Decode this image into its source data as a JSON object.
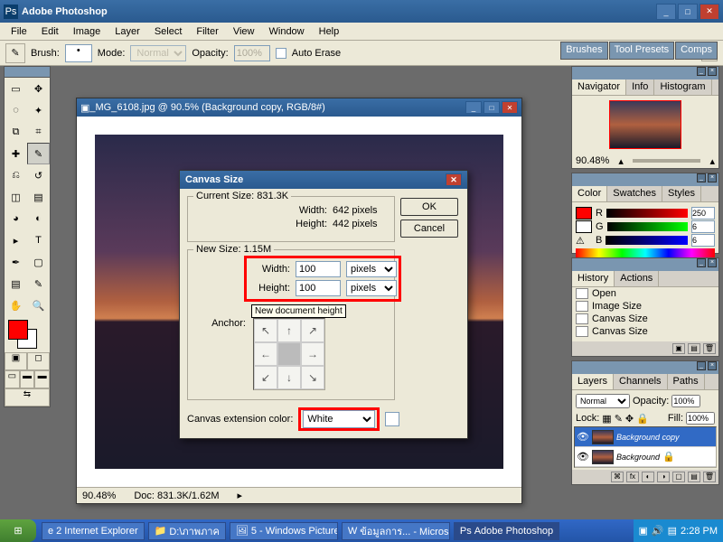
{
  "app": {
    "title": "Adobe Photoshop"
  },
  "menu": [
    "File",
    "Edit",
    "Image",
    "Layer",
    "Select",
    "Filter",
    "View",
    "Window",
    "Help"
  ],
  "options": {
    "brush_label": "Brush:",
    "mode_label": "Mode:",
    "mode_value": "Normal",
    "opacity_label": "Opacity:",
    "opacity_value": "100%",
    "auto_erase": "Auto Erase"
  },
  "panel_tabs": [
    "Brushes",
    "Tool Presets",
    "Comps"
  ],
  "doc": {
    "title": "_MG_6108.jpg @ 90.5% (Background copy, RGB/8#)",
    "zoom": "90.48%",
    "docsize": "Doc: 831.3K/1.62M"
  },
  "dialog": {
    "title": "Canvas Size",
    "current_label": "Current Size: 831.3K",
    "cur_width_l": "Width:",
    "cur_width_v": "642 pixels",
    "cur_height_l": "Height:",
    "cur_height_v": "442 pixels",
    "new_label": "New Size: 1.15M",
    "new_width_l": "Width:",
    "new_width_v": "100",
    "new_width_u": "pixels",
    "new_height_l": "Height:",
    "new_height_v": "100",
    "new_height_u": "pixels",
    "tooltip": "New document height",
    "anchor_l": "Anchor:",
    "ext_label": "Canvas extension color:",
    "ext_value": "White",
    "ok": "OK",
    "cancel": "Cancel"
  },
  "nav": {
    "tabs": [
      "Navigator",
      "Info",
      "Histogram"
    ],
    "zoom": "90.48%"
  },
  "color": {
    "tabs": [
      "Color",
      "Swatches",
      "Styles"
    ],
    "r": "R",
    "g": "G",
    "b": "B",
    "rv": "250",
    "gv": "6",
    "bv": "6"
  },
  "history": {
    "tabs": [
      "History",
      "Actions"
    ],
    "items": [
      "Open",
      "Image Size",
      "Canvas Size",
      "Canvas Size"
    ]
  },
  "layers": {
    "tabs": [
      "Layers",
      "Channels",
      "Paths"
    ],
    "blend": "Normal",
    "opacity_l": "Opacity:",
    "opacity": "100%",
    "lock_l": "Lock:",
    "fill_l": "Fill:",
    "fill": "100%",
    "items": [
      {
        "name": "Background copy",
        "sel": true
      },
      {
        "name": "Background",
        "sel": false
      }
    ]
  },
  "taskbar": {
    "items": [
      "2 Internet Explorer",
      "D:\\ภาพภาค",
      "5 - Windows Picture...",
      "ข้อมูลการ... - Micros...",
      "Adobe Photoshop"
    ],
    "time": "2:28 PM"
  }
}
